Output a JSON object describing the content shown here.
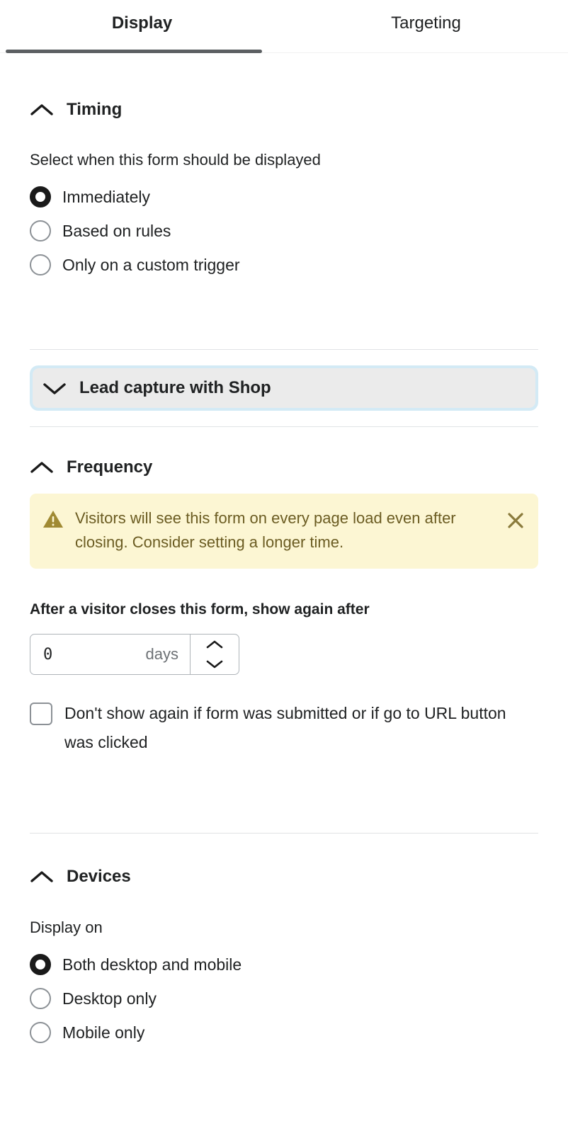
{
  "tabs": [
    {
      "label": "Display",
      "active": true
    },
    {
      "label": "Targeting",
      "active": false
    }
  ],
  "timing": {
    "title": "Timing",
    "chevron": "chevron-up-icon",
    "helper": "Select when this form should be displayed",
    "options": [
      {
        "label": "Immediately",
        "selected": true
      },
      {
        "label": "Based on rules",
        "selected": false
      },
      {
        "label": "Only on a custom trigger",
        "selected": false
      }
    ]
  },
  "shop_banner": {
    "title": "Lead capture with Shop",
    "chevron": "chevron-down-icon"
  },
  "frequency": {
    "title": "Frequency",
    "chevron": "chevron-up-icon",
    "warning": {
      "icon": "warning-triangle-icon",
      "text": "Visitors will see this form on every page load even after closing. Consider setting a longer time.",
      "close_icon": "close-icon"
    },
    "field_label": "After a visitor closes this form, show again after",
    "value": "0",
    "suffix": "days",
    "stepper_up_icon": "chevron-up-icon",
    "stepper_down_icon": "chevron-down-icon",
    "checkbox": {
      "label": "Don't show again if form was submitted or if go to URL button was clicked",
      "checked": false
    }
  },
  "devices": {
    "title": "Devices",
    "chevron": "chevron-up-icon",
    "helper": "Display on",
    "options": [
      {
        "label": "Both desktop and mobile",
        "selected": true
      },
      {
        "label": "Desktop only",
        "selected": false
      },
      {
        "label": "Mobile only",
        "selected": false
      }
    ]
  },
  "colors": {
    "accent_underline": "#5c5f62",
    "banner_ring": "#d3eaf5",
    "banner_fill": "#ebebeb",
    "warning_bg": "#fcf6d3",
    "warning_text": "#6b5c22",
    "divider": "#e1e3e5",
    "radio_border": "#8c9196",
    "radio_selected": "#1a1a1a"
  }
}
